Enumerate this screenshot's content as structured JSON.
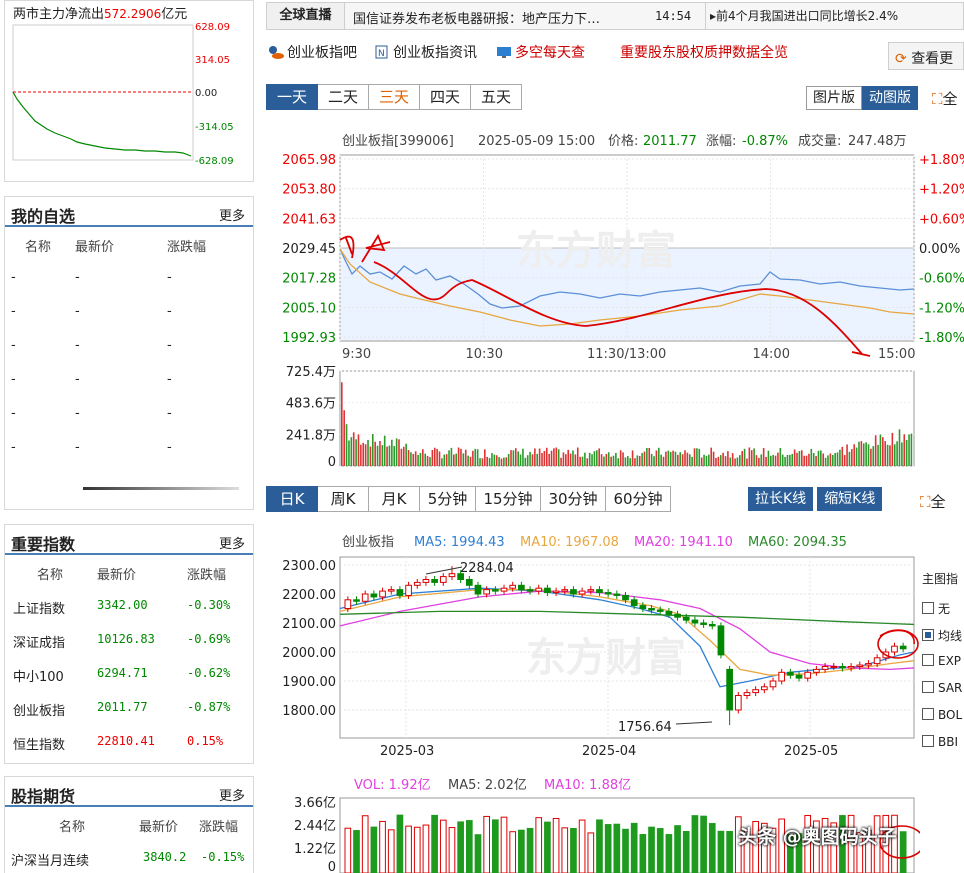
{
  "left": {
    "flow": {
      "title": "两市主力净流出",
      "value": "572.2906",
      "unit": "亿元",
      "y_labels": [
        "628.09",
        "314.05",
        "0.00",
        "-314.05",
        "-628.09"
      ]
    },
    "watchlist": {
      "title": "我的自选",
      "more": "更多",
      "headers": [
        "名称",
        "最新价",
        "涨跌幅"
      ],
      "rows": [
        [
          "-",
          "-",
          "-"
        ],
        [
          "-",
          "-",
          "-"
        ],
        [
          "-",
          "-",
          "-"
        ],
        [
          "-",
          "-",
          "-"
        ],
        [
          "-",
          "-",
          "-"
        ],
        [
          "-",
          "-",
          "-"
        ]
      ]
    },
    "indices": {
      "title": "重要指数",
      "more": "更多",
      "headers": [
        "名称",
        "最新价",
        "涨跌幅"
      ],
      "rows": [
        {
          "name": "上证指数",
          "price": "3342.00",
          "chg": "-0.30%",
          "dir": "down"
        },
        {
          "name": "深证成指",
          "price": "10126.83",
          "chg": "-0.69%",
          "dir": "down"
        },
        {
          "name": "中小100",
          "price": "6294.71",
          "chg": "-0.62%",
          "dir": "down"
        },
        {
          "name": "创业板指",
          "price": "2011.77",
          "chg": "-0.87%",
          "dir": "down"
        },
        {
          "name": "恒生指数",
          "price": "22810.41",
          "chg": "0.15%",
          "dir": "up"
        }
      ]
    },
    "futures": {
      "title": "股指期货",
      "more": "更多",
      "headers": [
        "名称",
        "最新价",
        "涨跌幅"
      ],
      "rows": [
        {
          "name": "沪深当月连续",
          "price": "3840.2",
          "chg": "-0.15%"
        }
      ]
    }
  },
  "news": {
    "label": "全球直播",
    "text": "国信证券发布老板电器研报：地产压力下…",
    "time": "14:54",
    "next": "前4个月我国进出口同比增长2.4%"
  },
  "links": [
    "创业板指吧",
    "创业板指资讯",
    "多空每天查",
    "重要股东股权质押数据全览"
  ],
  "view_more": "查看更",
  "intraday": {
    "day_tabs": [
      "一天",
      "二天",
      "三天",
      "四天",
      "五天"
    ],
    "view_btns": [
      "图片版",
      "动图版"
    ],
    "fullscreen": "全",
    "header": {
      "name": "创业板指[399006]",
      "datetime": "2025-05-09 15:00",
      "price_label": "价格:",
      "price": "2011.77",
      "chg_label": "涨幅:",
      "chg": "-0.87%",
      "vol_label": "成交量:",
      "vol": "247.48万"
    },
    "watermark": "东方财富",
    "y_labels_left": [
      "2065.98",
      "2053.80",
      "2041.63",
      "2029.45",
      "2017.28",
      "2005.10",
      "1992.93"
    ],
    "y_labels_right": [
      "+1.80%",
      "+1.20%",
      "+0.60%",
      "0.00%",
      "-0.60%",
      "-1.20%",
      "-1.80%"
    ],
    "x_labels": [
      "9:30",
      "10:30",
      "11:30/13:00",
      "14:00",
      "15:00"
    ],
    "vol_labels": [
      "725.4万",
      "483.6万",
      "241.8万",
      "0"
    ]
  },
  "kline": {
    "period_tabs": [
      "日K",
      "周K",
      "月K",
      "5分钟",
      "15分钟",
      "30分钟",
      "60分钟"
    ],
    "btns": [
      "拉长K线",
      "缩短K线"
    ],
    "fullscreen": "全",
    "legend": {
      "name": "创业板指",
      "ma5": "MA5: 1994.43",
      "ma10": "MA10: 1967.08",
      "ma20": "MA20: 1941.10",
      "ma60": "MA60: 2094.35"
    },
    "y_labels": [
      "2300.00",
      "2200.00",
      "2100.00",
      "2000.00",
      "1900.00",
      "1800.00"
    ],
    "x_labels": [
      "2025-03",
      "2025-04",
      "2025-05"
    ],
    "high_annot": "2284.04",
    "low_annot": "1756.64",
    "side_title": "主图指",
    "side_items": [
      "无",
      "均线",
      "EXP",
      "SAR",
      "BOL",
      "BBI"
    ],
    "vol_legend": {
      "vol": "VOL: 1.92亿",
      "ma5": "MA5: 2.02亿",
      "ma10": "MA10: 1.88亿"
    },
    "vol_labels": [
      "3.66亿",
      "2.44亿",
      "1.22亿",
      "0"
    ]
  },
  "colors": {
    "up": "#e00000",
    "down": "#008000",
    "accent": "#2b5e98"
  },
  "credit": "头条 @奥图码头子"
}
